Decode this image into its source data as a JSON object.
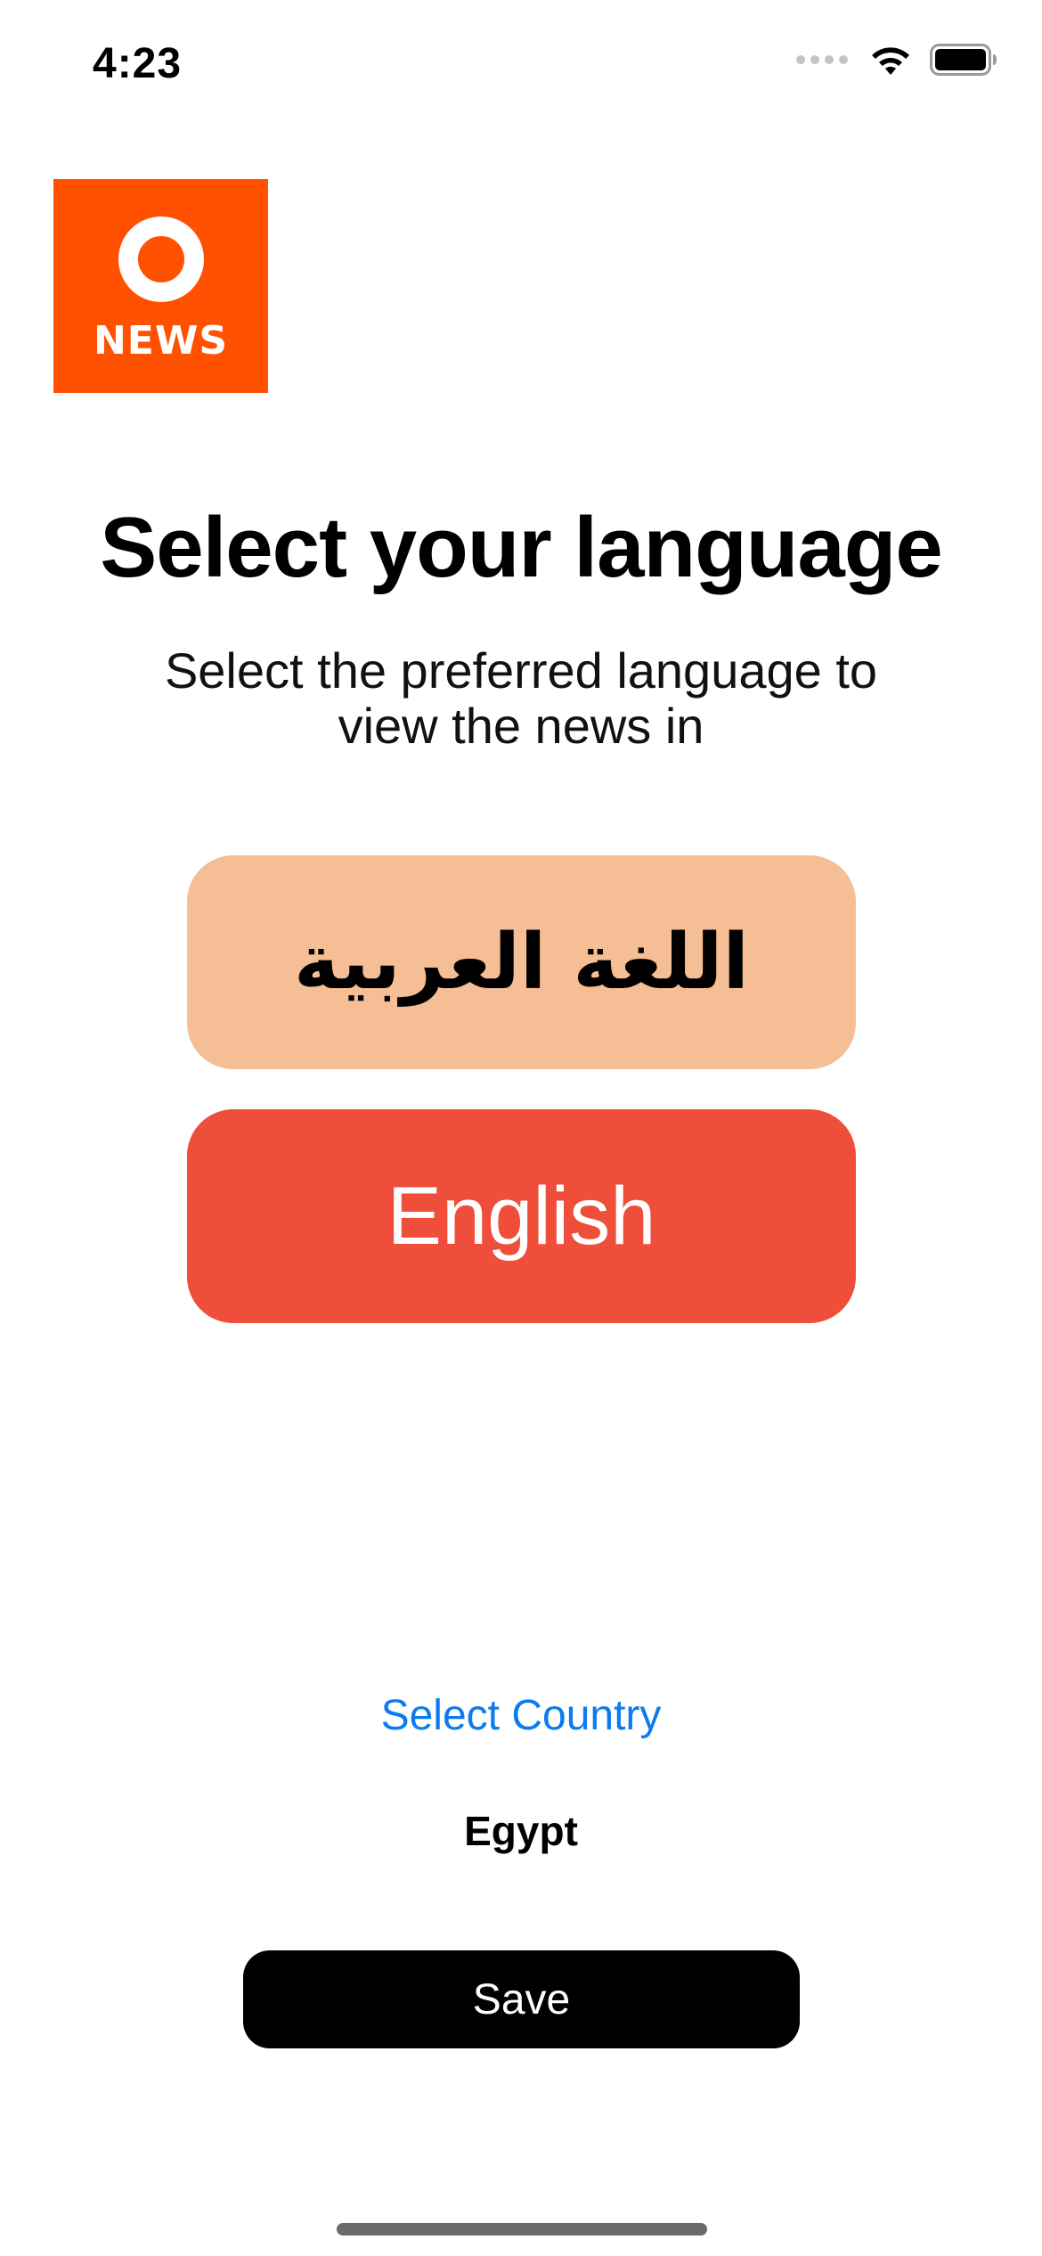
{
  "status_bar": {
    "time": "4:23"
  },
  "logo": {
    "text": "NEWS",
    "color": "#ff5100"
  },
  "header": {
    "title": "Select your language",
    "subtitle_line1": "Select the preferred language to",
    "subtitle_line2": "view the news in"
  },
  "languages": [
    {
      "label": "اللغة العربية",
      "color": "#f5be94"
    },
    {
      "label": "English",
      "color": "#ef4e3a"
    }
  ],
  "country": {
    "link_label": "Select Country",
    "value": "Egypt"
  },
  "actions": {
    "save_label": "Save"
  }
}
